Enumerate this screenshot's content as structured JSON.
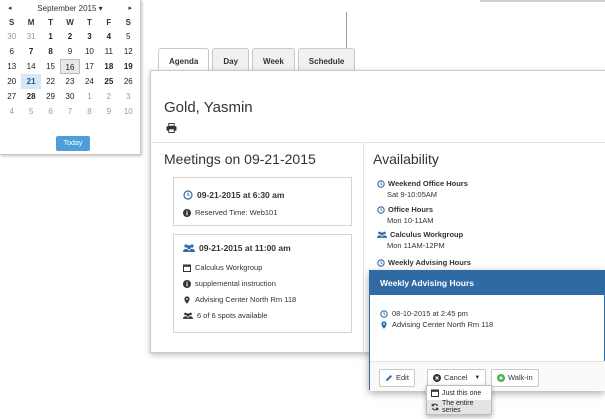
{
  "calendar": {
    "month_label": "September 2015 ▾",
    "prev": "◂",
    "next": "▸",
    "weekdays": [
      "S",
      "M",
      "T",
      "W",
      "T",
      "F",
      "S"
    ],
    "weeks": [
      [
        "30",
        "31",
        "1",
        "2",
        "3",
        "4",
        "5"
      ],
      [
        "6",
        "7",
        "8",
        "9",
        "10",
        "11",
        "12"
      ],
      [
        "13",
        "14",
        "15",
        "16",
        "17",
        "18",
        "19"
      ],
      [
        "20",
        "21",
        "22",
        "23",
        "24",
        "25",
        "26"
      ],
      [
        "27",
        "28",
        "29",
        "30",
        "1",
        "2",
        "3"
      ],
      [
        "4",
        "5",
        "6",
        "7",
        "8",
        "9",
        "10"
      ]
    ],
    "today_label": "Today"
  },
  "tabs": [
    "Agenda",
    "Day",
    "Week",
    "Schedule"
  ],
  "student": {
    "name": "Gold, Yasmin"
  },
  "meetings": {
    "heading": "Meetings on 09-21-2015",
    "first": {
      "time": "09-21-2015 at 6:30 am",
      "detail": "Reserved Time: Web101"
    },
    "second": {
      "time": "09-21-2015 at 11:00 am",
      "lines": [
        "Calculus Workgroup",
        "supplemental instruction",
        "Advising Center North Rm 118",
        "6 of 6 spots available"
      ]
    }
  },
  "availability": {
    "heading": "Availability",
    "items": [
      {
        "title": "Weekend Office Hours",
        "sub": "Sat 9-10:05AM"
      },
      {
        "title": "Office Hours",
        "sub": "Mon 10-11AM"
      },
      {
        "title": "Calculus Workgroup",
        "sub": "Mon 11AM-12PM"
      },
      {
        "title": "Weekly Advising Hours",
        "sub": ""
      }
    ]
  },
  "popup": {
    "title": "Weekly Advising Hours",
    "datetime": "08-10-2015 at 2:45 pm",
    "location": "Advising Center North Rm 118",
    "edit": "Edit",
    "cancel": "Cancel",
    "walkin": "Walk-in"
  },
  "cancel_menu": [
    "Just this one",
    "The entire series"
  ],
  "colors": {
    "accent": "#2f6aa5",
    "today_button": "#4d9fdc",
    "walkin_icon": "#4cae4c"
  }
}
